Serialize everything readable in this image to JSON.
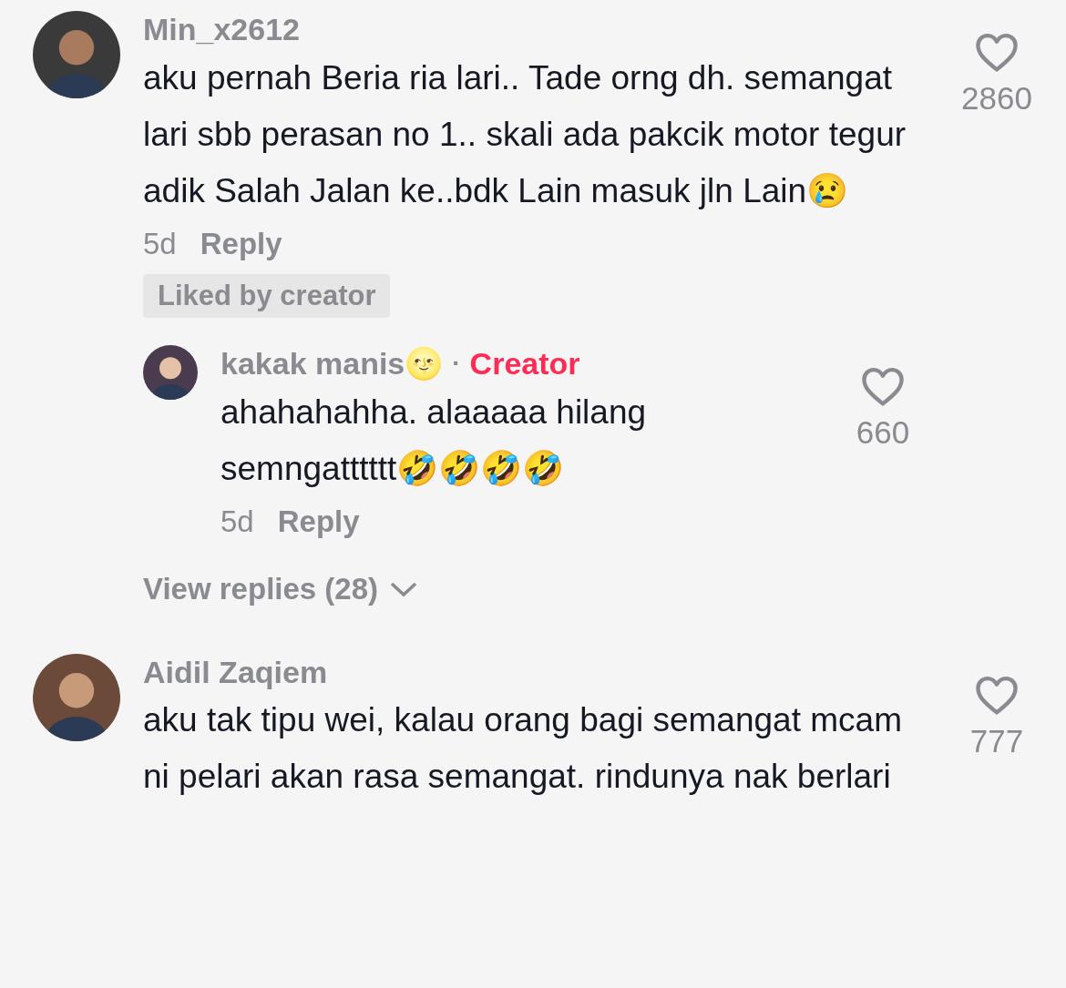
{
  "comments": [
    {
      "username": "Min_x2612",
      "text": "aku pernah Beria ria lari.. Tade orng dh. semangat lari sbb perasan no 1.. skali ada pakcik motor tegur adik Salah Jalan ke..bdk Lain masuk jln Lain😢",
      "time": "5d",
      "reply_label": "Reply",
      "likes": "2860",
      "liked": false,
      "badge": "Liked by creator",
      "replies": [
        {
          "username": "kakak manis🌝",
          "separator": "·",
          "role": "Creator",
          "text": "ahahahahha. alaaaaa hilang semngatttttt🤣🤣🤣🤣",
          "time": "5d",
          "reply_label": "Reply",
          "likes": "660",
          "liked": false
        }
      ],
      "view_replies": "View replies (28)"
    },
    {
      "username": "Aidil Zaqiem",
      "text": "aku tak tipu wei, kalau orang bagi semangat mcam ni pelari akan rasa semangat. rindunya nak berlari",
      "likes": "777",
      "liked": false
    }
  ]
}
